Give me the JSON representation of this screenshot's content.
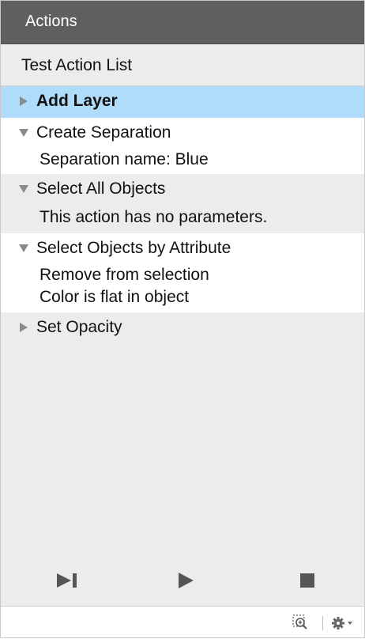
{
  "panel": {
    "title": "Actions",
    "list_name": "Test Action List"
  },
  "actions": [
    {
      "label": "Add Layer",
      "expanded": false,
      "selected": true,
      "params": []
    },
    {
      "label": "Create Separation",
      "expanded": true,
      "selected": false,
      "params": [
        "Separation name: Blue"
      ]
    },
    {
      "label": "Select All Objects",
      "expanded": true,
      "selected": false,
      "params": [
        "This action has no parameters."
      ]
    },
    {
      "label": "Select Objects by Attribute",
      "expanded": true,
      "selected": false,
      "params": [
        "Remove from selection",
        "Color is flat in object"
      ]
    },
    {
      "label": "Set Opacity",
      "expanded": false,
      "selected": false,
      "params": []
    }
  ],
  "controls": {
    "step": "step-forward-icon",
    "play": "play-icon",
    "stop": "stop-icon"
  },
  "footer": {
    "zoom": "zoom-to-object-icon",
    "settings": "gear-menu-icon"
  },
  "colors": {
    "title_bar": "#5f5f5f",
    "selection": "#aedcf9",
    "panel_bg": "#ececec",
    "icon": "#555555"
  }
}
